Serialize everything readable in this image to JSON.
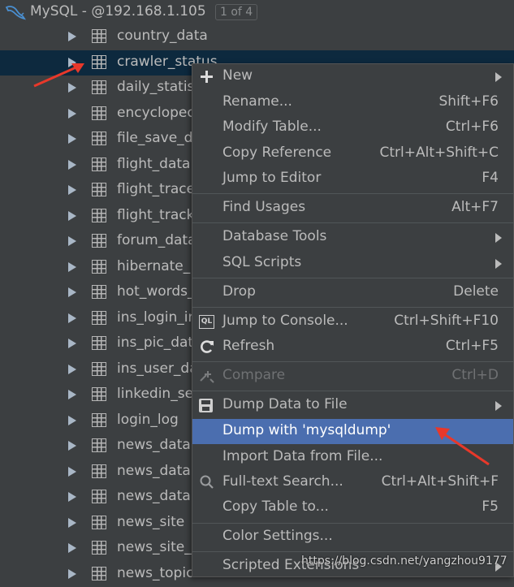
{
  "header": {
    "title": "MySQL - @192.168.1.105",
    "badge": "1 of 4"
  },
  "tree": [
    {
      "label": "country_data"
    },
    {
      "label": "crawler_status",
      "selected": true
    },
    {
      "label": "daily_statis"
    },
    {
      "label": "encyclopec"
    },
    {
      "label": "file_save_d"
    },
    {
      "label": "flight_data"
    },
    {
      "label": "flight_trace"
    },
    {
      "label": "flight_track"
    },
    {
      "label": "forum_data"
    },
    {
      "label": "hibernate_"
    },
    {
      "label": "hot_words_"
    },
    {
      "label": "ins_login_ir"
    },
    {
      "label": "ins_pic_dat"
    },
    {
      "label": "ins_user_da"
    },
    {
      "label": "linkedin_se"
    },
    {
      "label": "login_log"
    },
    {
      "label": "news_data"
    },
    {
      "label": "news_data"
    },
    {
      "label": "news_data"
    },
    {
      "label": "news_site"
    },
    {
      "label": "news_site_"
    },
    {
      "label": "news_topic"
    }
  ],
  "menu": {
    "new": "New",
    "rename": "Rename...",
    "rename_sc": "Shift+F6",
    "modify": "Modify Table...",
    "modify_sc": "Ctrl+F6",
    "copy_ref": "Copy Reference",
    "copy_ref_sc": "Ctrl+Alt+Shift+C",
    "jump_editor": "Jump to Editor",
    "jump_editor_sc": "F4",
    "find_usages": "Find Usages",
    "find_usages_sc": "Alt+F7",
    "db_tools": "Database Tools",
    "sql_scripts": "SQL Scripts",
    "drop": "Drop",
    "drop_sc": "Delete",
    "jump_console": "Jump to Console...",
    "jump_console_sc": "Ctrl+Shift+F10",
    "refresh": "Refresh",
    "refresh_sc": "Ctrl+F5",
    "compare": "Compare",
    "compare_sc": "Ctrl+D",
    "dump_file": "Dump Data to File",
    "dump_mysqldump": "Dump with 'mysqldump'",
    "import_file": "Import Data from File...",
    "fulltext": "Full-text Search...",
    "fulltext_sc": "Ctrl+Alt+Shift+F",
    "copy_table": "Copy Table to...",
    "copy_table_sc": "F5",
    "color_settings": "Color Settings...",
    "scripted_ext": "Scripted Extensions",
    "console_icon_text": "QL"
  },
  "watermark": "https://blog.csdn.net/yangzhou9177",
  "colors": {
    "background": "#3c3f41",
    "selected_row": "#0d293e",
    "menu_highlight": "#4b6eaf",
    "annotation_arrow": "#e8382a"
  }
}
